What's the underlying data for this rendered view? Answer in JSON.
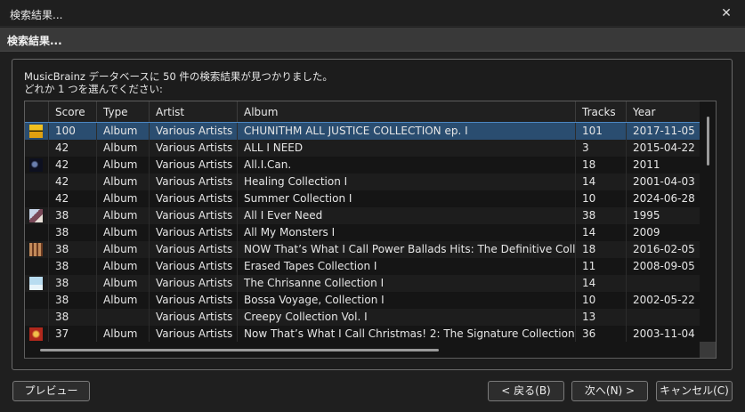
{
  "window": {
    "title": "検索結果...",
    "close_label": "✕"
  },
  "header": {
    "label": "検索結果..."
  },
  "message": {
    "line1": "MusicBrainz データベースに 50 件の検索結果が見つかりました。",
    "line2": "どれか 1 つを選んでください:"
  },
  "columns": [
    "Score",
    "Type",
    "Artist",
    "Album",
    "Tracks",
    "Year"
  ],
  "rows": [
    {
      "score": "100",
      "type": "Album",
      "artist": "Various Artists",
      "album": "CHUNITHM ALL JUSTICE COLLECTION ep. I",
      "tracks": "101",
      "year": "2017-11-05",
      "art": "yellow-cover-icon"
    },
    {
      "score": "42",
      "type": "Album",
      "artist": "Various Artists",
      "album": "ALL I NEED",
      "tracks": "3",
      "year": "2015-04-22",
      "art": ""
    },
    {
      "score": "42",
      "type": "Album",
      "artist": "Various Artists",
      "album": "All.I.Can.",
      "tracks": "18",
      "year": "2011",
      "art": "dark-cover-icon"
    },
    {
      "score": "42",
      "type": "Album",
      "artist": "Various Artists",
      "album": "Healing Collection I",
      "tracks": "14",
      "year": "2001-04-03",
      "art": ""
    },
    {
      "score": "42",
      "type": "Album",
      "artist": "Various Artists",
      "album": "Summer Collection I",
      "tracks": "10",
      "year": "2024-06-28",
      "art": ""
    },
    {
      "score": "38",
      "type": "Album",
      "artist": "Various Artists",
      "album": "All I Ever Need",
      "tracks": "38",
      "year": "1995",
      "art": "photo-cover-icon"
    },
    {
      "score": "38",
      "type": "Album",
      "artist": "Various Artists",
      "album": "All My Monsters I",
      "tracks": "14",
      "year": "2009",
      "art": ""
    },
    {
      "score": "38",
      "type": "Album",
      "artist": "Various Artists",
      "album": "NOW That’s What I Call Power Ballads Hits: The Definitive Collection",
      "tracks": "18",
      "year": "2016-02-05",
      "art": "grid-cover-icon"
    },
    {
      "score": "38",
      "type": "Album",
      "artist": "Various Artists",
      "album": "Erased Tapes Collection I",
      "tracks": "11",
      "year": "2008-09-05",
      "art": ""
    },
    {
      "score": "38",
      "type": "Album",
      "artist": "Various Artists",
      "album": "The Chrisanne Collection I",
      "tracks": "14",
      "year": "",
      "art": "light-cover-icon"
    },
    {
      "score": "38",
      "type": "Album",
      "artist": "Various Artists",
      "album": "Bossa Voyage, Collection I",
      "tracks": "10",
      "year": "2002-05-22",
      "art": ""
    },
    {
      "score": "38",
      "type": "",
      "artist": "Various Artists",
      "album": "Creepy Collection Vol. I",
      "tracks": "13",
      "year": "",
      "art": ""
    },
    {
      "score": "37",
      "type": "Album",
      "artist": "Various Artists",
      "album": "Now That’s What I Call Christmas! 2: The Signature Collection",
      "tracks": "36",
      "year": "2003-11-04",
      "art": "christmas-cover-icon"
    }
  ],
  "buttons": {
    "preview": "プレビュー",
    "back": "< 戻る(B)",
    "next": "次へ(N) >",
    "cancel": "キャンセル(C)"
  },
  "colors": {
    "selection": "#2a4d70",
    "selection_border": "#4b87c2",
    "background": "#1f1f1f"
  }
}
